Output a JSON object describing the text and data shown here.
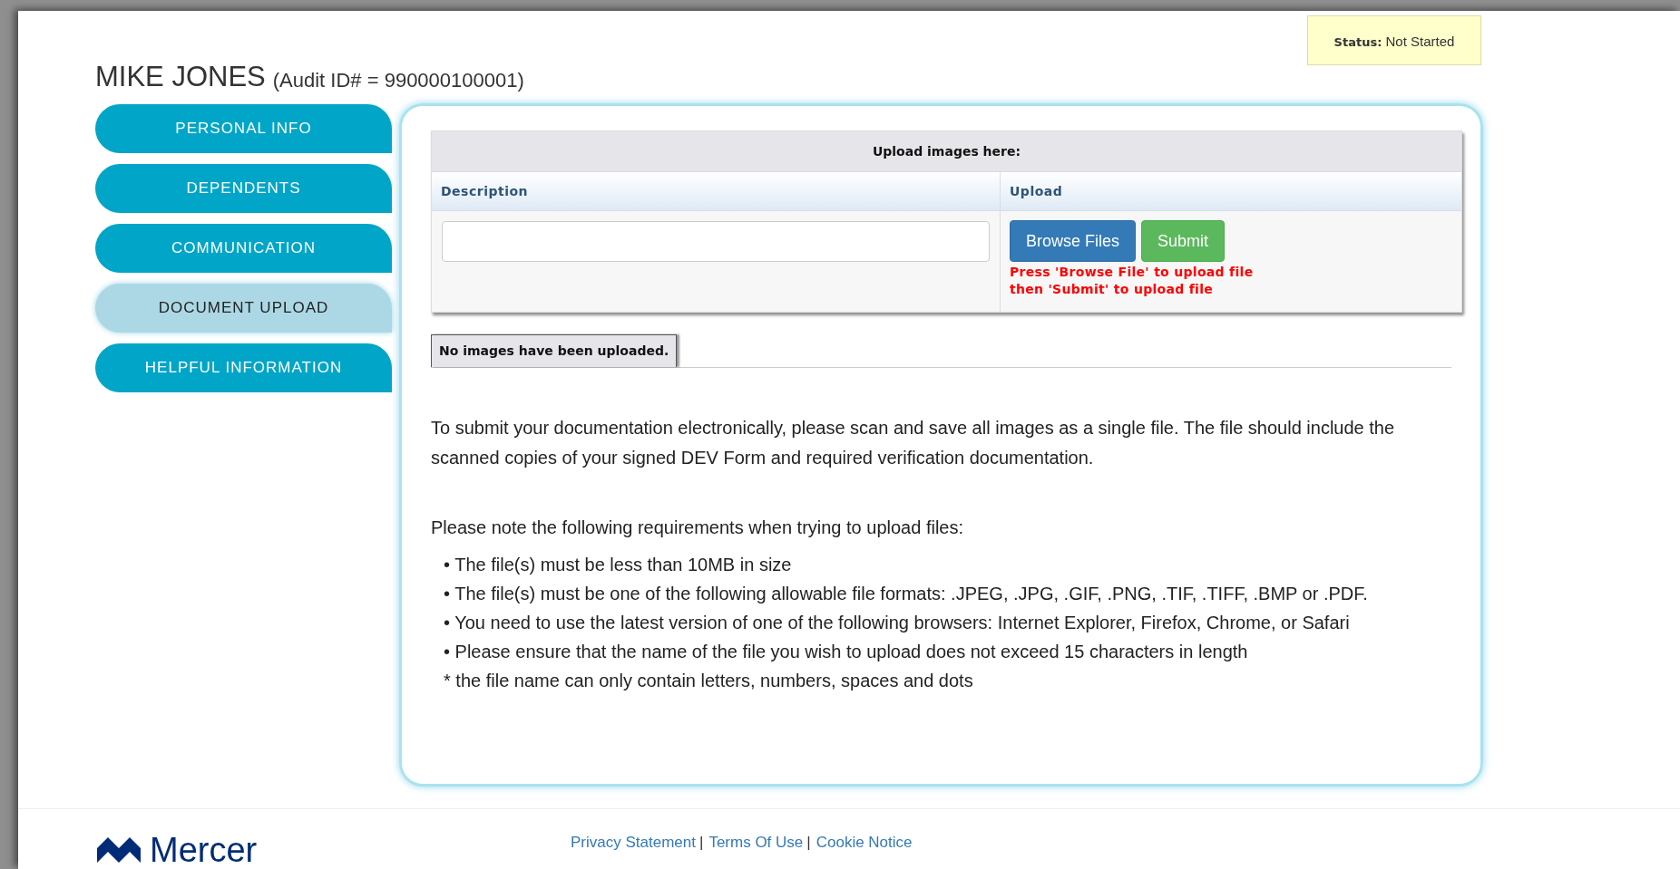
{
  "status": {
    "label": "Status:",
    "value": "Not Started"
  },
  "header": {
    "name": "MIKE JONES",
    "audit_id": "(Audit ID# = 990000100001)"
  },
  "sidebar": {
    "items": [
      {
        "label": "PERSONAL INFO",
        "selected": false
      },
      {
        "label": "DEPENDENTS",
        "selected": false
      },
      {
        "label": "COMMUNICATION",
        "selected": false
      },
      {
        "label": "DOCUMENT UPLOAD",
        "selected": true
      },
      {
        "label": "HELPFUL INFORMATION",
        "selected": false
      }
    ]
  },
  "upload_table": {
    "title": "Upload images here:",
    "columns": [
      "Description",
      "Upload"
    ],
    "buttons": [
      {
        "label": "Browse Files",
        "kind": "primary"
      },
      {
        "label": "Submit",
        "kind": "success"
      }
    ],
    "hint_lines": [
      "Press 'Browse File' to upload file",
      "then 'Submit' to upload file"
    ]
  },
  "uploads_tab": {
    "label": "No images have been uploaded."
  },
  "instructions": {
    "intro": "To submit your documentation electronically, please scan and save all images as a single file. The file should include the scanned copies of your signed DEV Form and required verification documentation.",
    "requirements_heading": "Please note the following requirements when trying to upload files:",
    "requirements": [
      "• The file(s) must be less than 10MB in size",
      "• The file(s) must be one of the following allowable file formats: .JPEG, .JPG, .GIF, .PNG, .TIF, .TIFF, .BMP or .PDF.",
      "• You need to use the latest version of one of the following browsers: Internet Explorer, Firefox, Chrome, or Safari",
      "• Please ensure that the name of the file you wish to upload does not exceed 15 characters in length",
      "* the file name can only contain letters, numbers, spaces and dots"
    ]
  },
  "footer": {
    "logo_text": "Mercer",
    "separator": "|",
    "links": [
      "Privacy Statement",
      "Terms Of Use",
      "Cookie Notice"
    ]
  }
}
